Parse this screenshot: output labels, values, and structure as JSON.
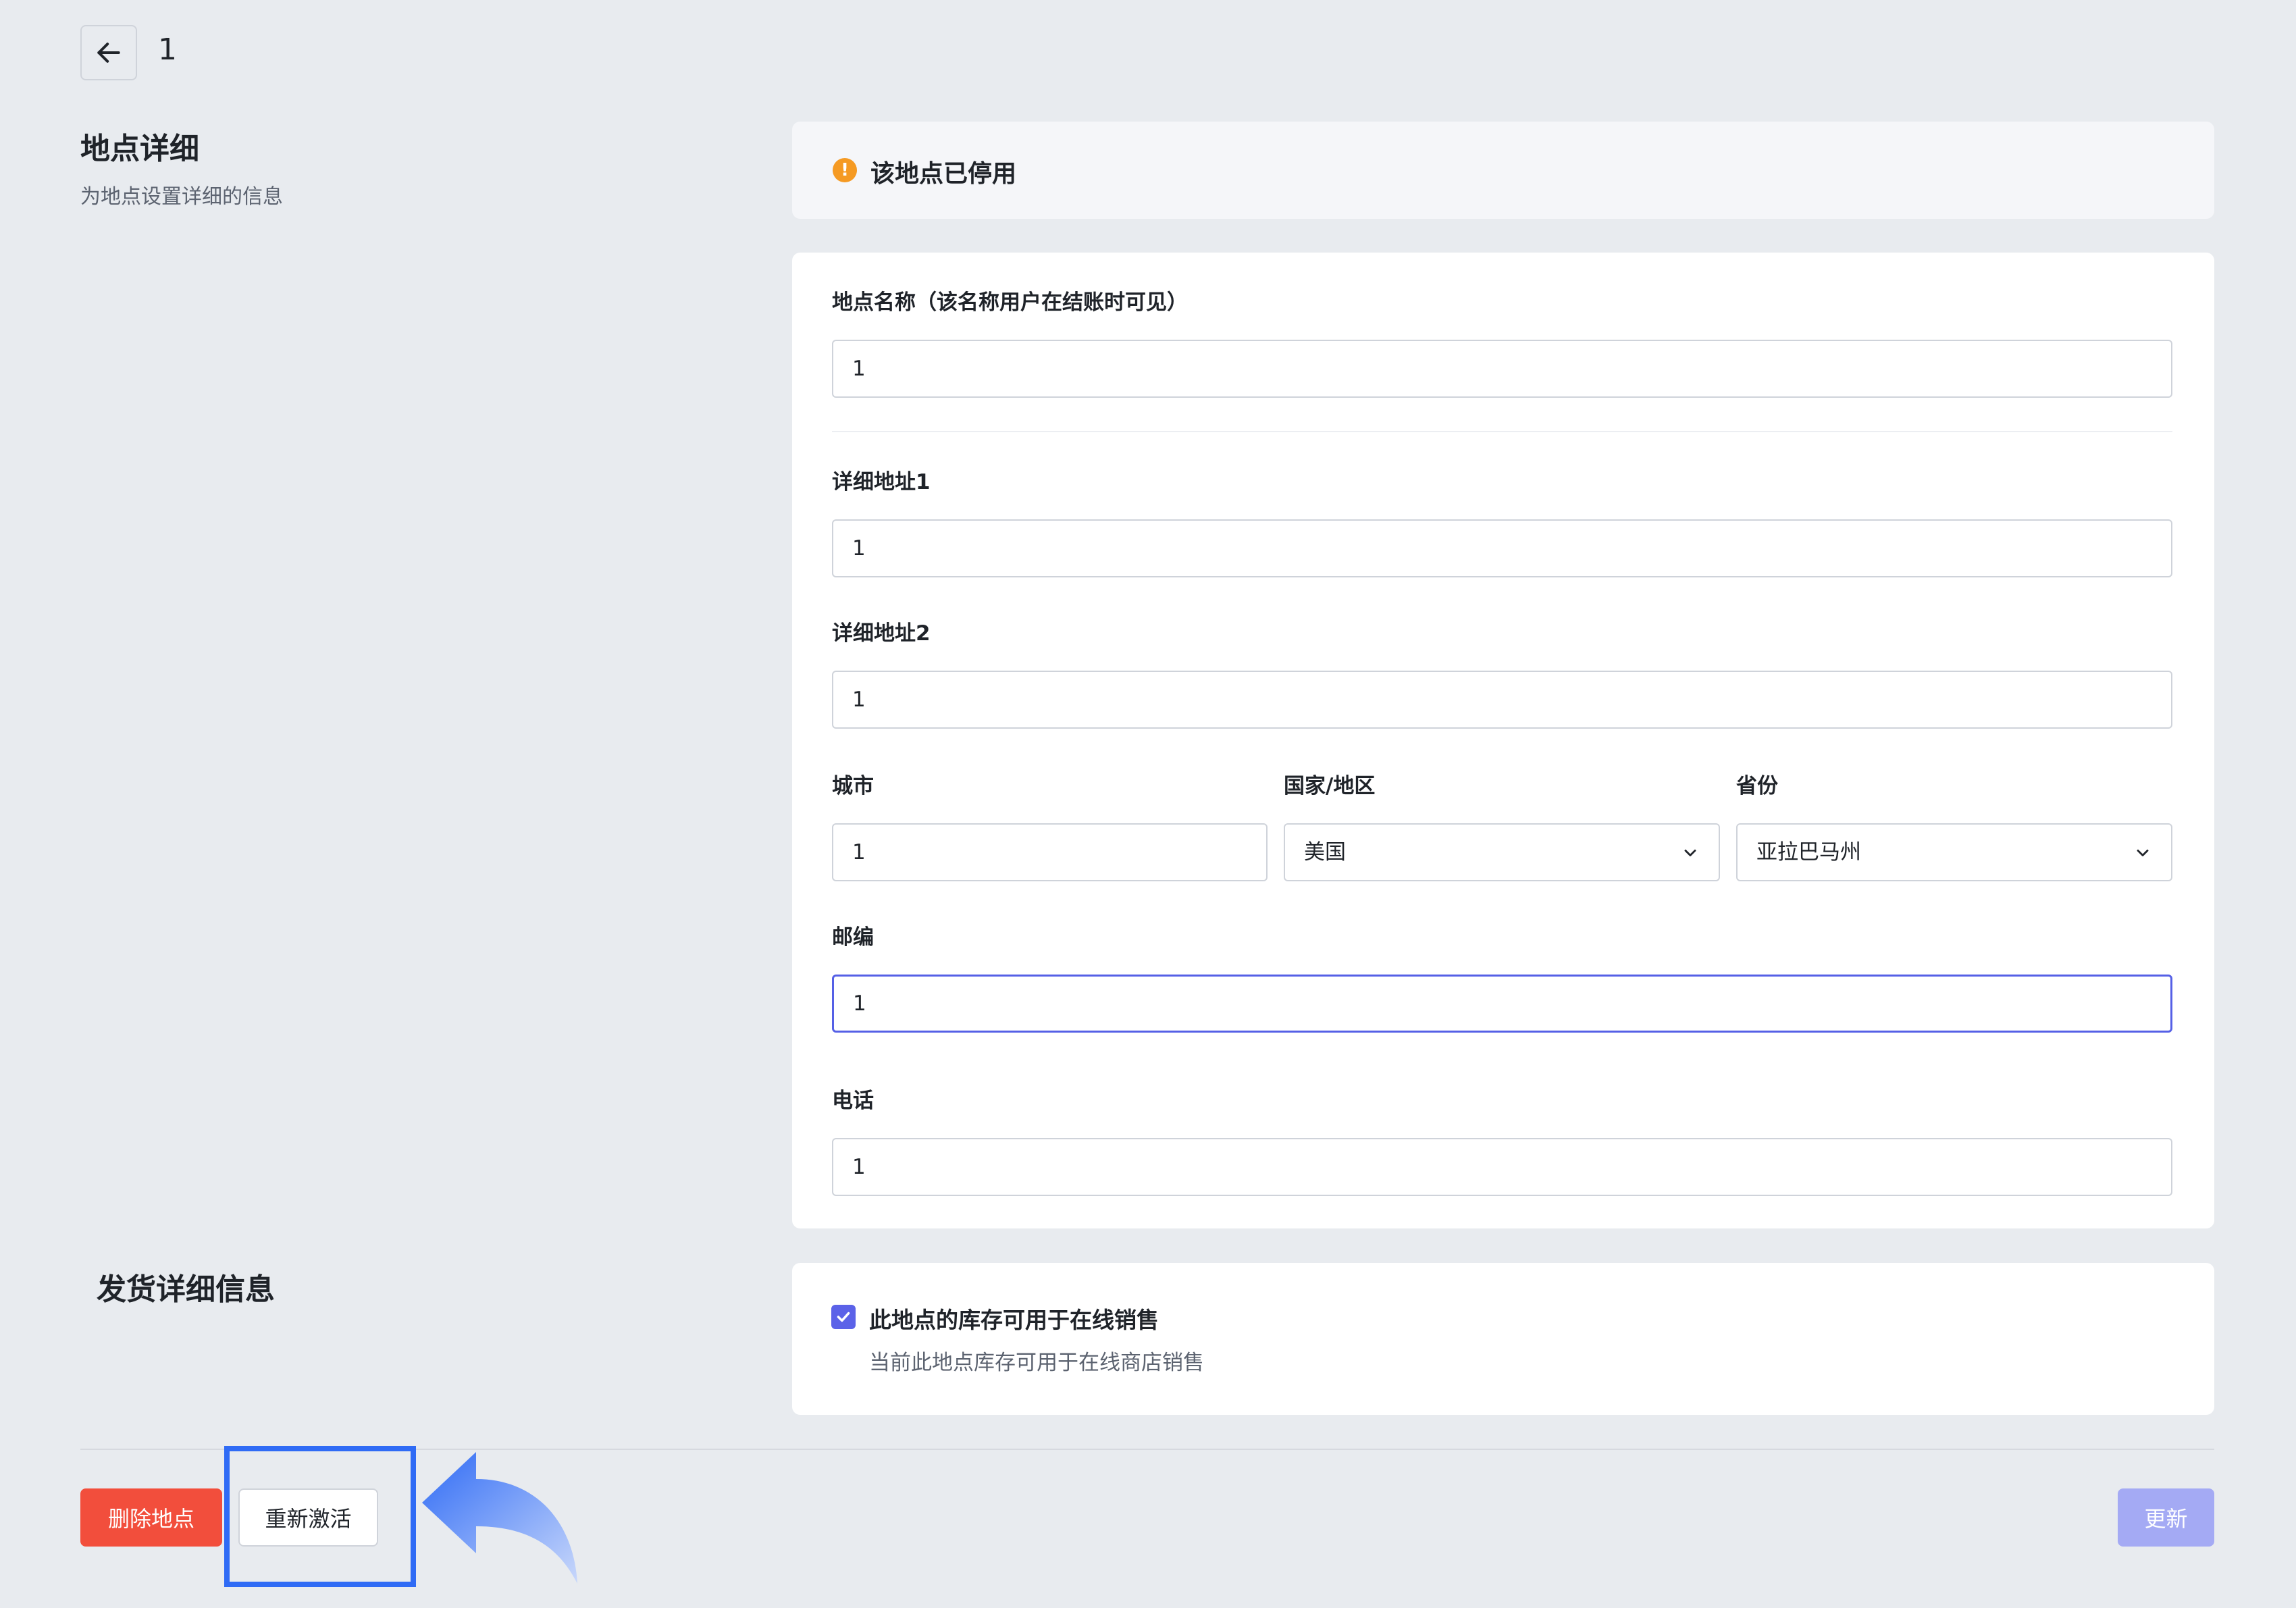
{
  "header": {
    "title": "1"
  },
  "location_section": {
    "title": "地点详细",
    "subtitle": "为地点设置详细的信息"
  },
  "banner": {
    "text": "该地点已停用",
    "icon": "warning-icon",
    "color": "#f59a23"
  },
  "form": {
    "name_label": "地点名称（该名称用户在结账时可见）",
    "name_value": "1",
    "address1_label": "详细地址1",
    "address1_value": "1",
    "address2_label": "详细地址2",
    "address2_value": "1",
    "city_label": "城市",
    "city_value": "1",
    "country_label": "国家/地区",
    "country_value": "美国",
    "province_label": "省份",
    "province_value": "亚拉巴马州",
    "zip_label": "邮编",
    "zip_value": "1",
    "phone_label": "电话",
    "phone_value": "1"
  },
  "shipping_section": {
    "title": "发货详细信息",
    "checkbox_label": "此地点的库存可用于在线销售",
    "checkbox_desc": "当前此地点库存可用于在线商店销售",
    "checked": true
  },
  "footer": {
    "delete_label": "删除地点",
    "reactivate_label": "重新激活",
    "update_label": "更新"
  },
  "colors": {
    "accent": "#5b62e8",
    "danger": "#f24e3c",
    "highlight": "#2f6bf5"
  }
}
